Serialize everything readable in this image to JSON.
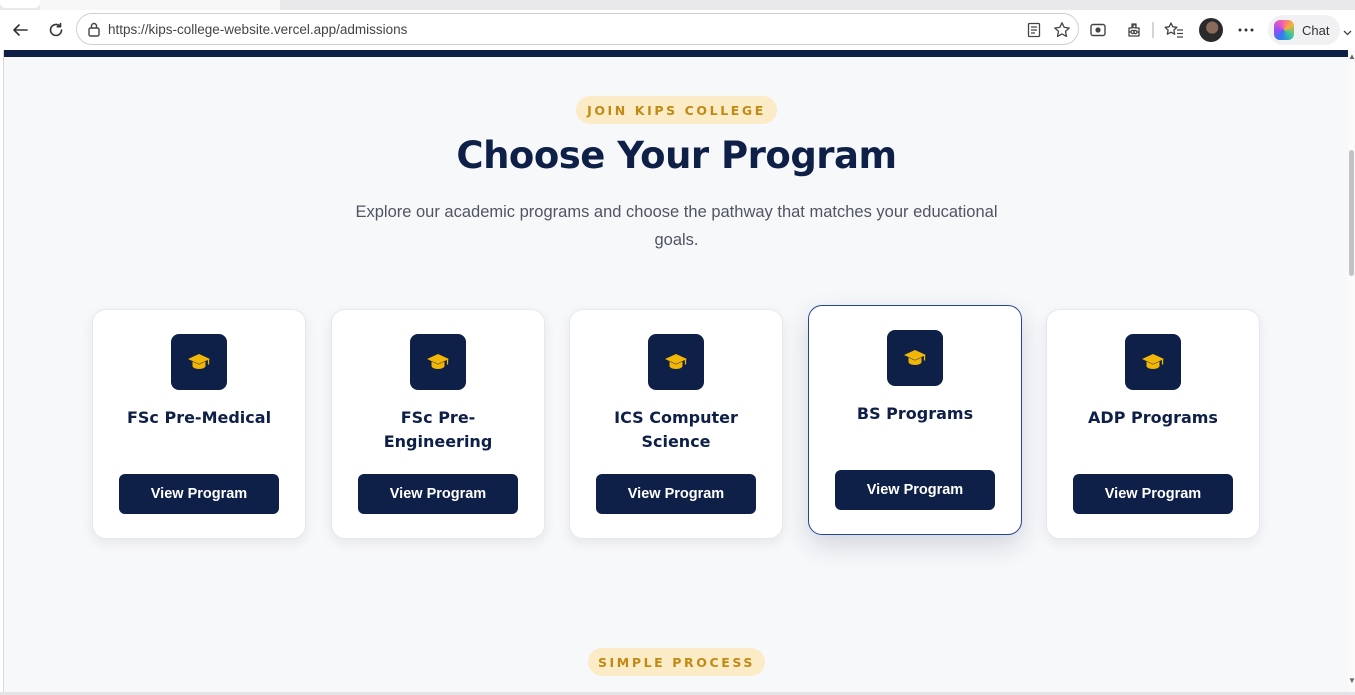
{
  "browser": {
    "url": "https://kips-college-website.vercel.app/admissions",
    "chat_label": "Chat",
    "icons": [
      "back-icon",
      "refresh-icon",
      "lock-icon",
      "reader-mode-icon",
      "favorite-star-icon",
      "screenshot-icon",
      "extensions-icon",
      "favorites-icon",
      "profile-avatar",
      "more-icon",
      "copilot-icon"
    ]
  },
  "section": {
    "badge": "JOIN KIPS COLLEGE",
    "title": "Choose Your Program",
    "subtitle": "Explore our academic programs and choose the pathway that matches your educational goals."
  },
  "programs": [
    {
      "title": "FSc Pre-Medical",
      "button": "View Program",
      "icon": "graduation-cap-icon"
    },
    {
      "title": "FSc Pre-Engineering",
      "button": "View Program",
      "icon": "graduation-cap-icon"
    },
    {
      "title": "ICS Computer Science",
      "button": "View Program",
      "icon": "graduation-cap-icon"
    },
    {
      "title": "BS Programs",
      "button": "View Program",
      "icon": "graduation-cap-icon"
    },
    {
      "title": "ADP Programs",
      "button": "View Program",
      "icon": "graduation-cap-icon"
    }
  ],
  "next_section": {
    "badge": "SIMPLE PROCESS"
  },
  "colors": {
    "navy": "#0e1f48",
    "gold": "#f2b705",
    "badge_bg": "#fbebc7",
    "badge_text": "#c08a14",
    "page_bg": "#f7f8fa"
  }
}
